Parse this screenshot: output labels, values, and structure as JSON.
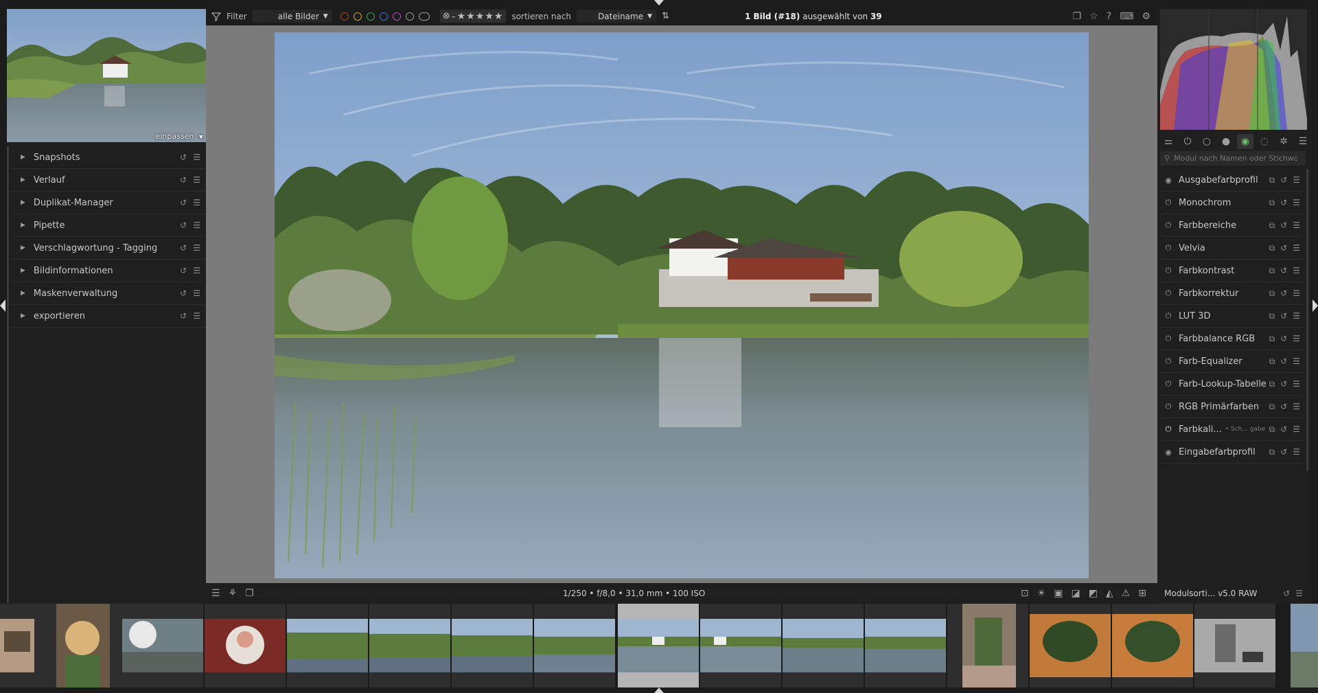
{
  "toolbar": {
    "filter_label": "Filter",
    "collection_value": "alle Bilder",
    "sort_label": "sortieren nach",
    "sort_value": "Dateiname",
    "selection_prefix": "1 Bild (#18)",
    "selection_middle": "ausgewählt von",
    "selection_total": "39",
    "color_labels": [
      "#c0392b",
      "#c9a227",
      "#3fa34d",
      "#3a6fd8",
      "#b04bb8",
      "#9a9a9a",
      "#9a9a9a"
    ]
  },
  "navigation": {
    "zoom_label": "einpassen"
  },
  "left_modules": [
    {
      "label": "Snapshots"
    },
    {
      "label": "Verlauf"
    },
    {
      "label": "Duplikat-Manager"
    },
    {
      "label": "Pipette"
    },
    {
      "label": "Verschlagwortung - Tagging"
    },
    {
      "label": "Bildinformationen"
    },
    {
      "label": "Maskenverwaltung"
    },
    {
      "label": "exportieren"
    }
  ],
  "module_search": {
    "placeholder": "Modul nach Namen oder Stichwo..."
  },
  "right_modules": [
    {
      "label": "Ausgabefarbprofil",
      "state": "always-on"
    },
    {
      "label": "Monochrom",
      "state": "off"
    },
    {
      "label": "Farbbereiche",
      "state": "off"
    },
    {
      "label": "Velvia",
      "state": "off"
    },
    {
      "label": "Farbkontrast",
      "state": "off"
    },
    {
      "label": "Farbkorrektur",
      "state": "off"
    },
    {
      "label": "LUT 3D",
      "state": "off"
    },
    {
      "label": "Farbbalance RGB",
      "state": "off"
    },
    {
      "label": "Farb-Equalizer",
      "state": "off"
    },
    {
      "label": "Farb-Lookup-Tabelle",
      "state": "off"
    },
    {
      "label": "RGB Primärfarben",
      "state": "off"
    },
    {
      "label": "Farbkali...",
      "state": "on",
      "sub": "• Sch... gabe"
    },
    {
      "label": "Eingabefarbprofil",
      "state": "always-on"
    }
  ],
  "bottom": {
    "exif": "1/250 • f/8,0 • 31,0 mm • 100 ISO",
    "module_order": "Modulsorti... v5.0 RAW"
  },
  "filmstrip": {
    "selected_index": 8
  }
}
